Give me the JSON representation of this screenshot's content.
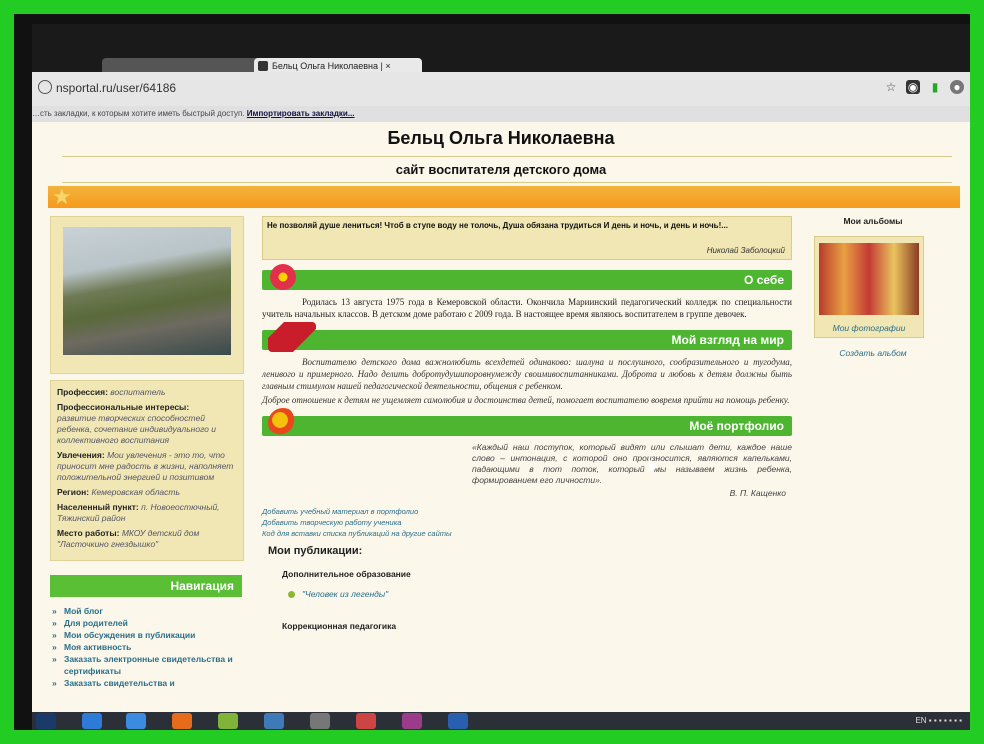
{
  "browser": {
    "tab_active_title": "Бельц Ольга Николаевна | ×",
    "address": "nsportal.ru/user/64186",
    "bookmarks_text": "…сть закладки, к которым хотите иметь быстрый доступ. ",
    "bookmarks_link": "Импортировать закладки..."
  },
  "site": {
    "title": "Бельц Ольга Николаевна",
    "subtitle": "сайт воспитателя детского дома"
  },
  "profile": {
    "profession_label": "Профессия:",
    "profession_value": "воспитатель",
    "interests_label": "Профессиональные интересы:",
    "interests_value": "развитие творческих способностей ребенка, сочетание индивидуального и коллективного воспитания",
    "hobbies_label": "Увлечения:",
    "hobbies_value": "Мои увлечения - это то, что приносит мне радость в жизни, наполняет положительной энергией и позитивом",
    "region_label": "Регион:",
    "region_value": "Кемеровская область",
    "locality_label": "Населенный пункт:",
    "locality_value": "п. Новоеостючный, Тяжинский район",
    "work_label": "Место работы:",
    "work_value": "МКОУ детский дом \"Ласточкино гнездышко\""
  },
  "nav": {
    "heading": "Навигация",
    "items": [
      "Мой блог",
      "Для родителей",
      "Мои обсуждения в публикации",
      "Моя активность",
      "Заказать электронные свидетельства и сертификаты",
      "Заказать свидетельства и"
    ]
  },
  "quote": {
    "text": "Не позволяй душе лениться! Чтоб в ступе воду не толочь, Душа обязана трудиться И день и ночь, и день и ночь!...",
    "author": "Николай Заболоцкий"
  },
  "sections": {
    "about_title": "О себе",
    "about_text": "Родилась 13 августа 1975 года в Кемеровской области. Окончила Мариинский педагогический колледж по специальности учитель начальных классов.    В детском доме работаю с 2009 года.  В настоящее время являюсь воспитателем в группе девочек.",
    "view_title": "Мой взгляд на мир",
    "view_text1": "Воспитателю детского дома важнолюбить всехдетей одинаково: шалуна и послушного, сообразительного и тугодума, ленивого и примерного. Надо делить добротудушипоровнумежду своимивоспитанниками. Доброта и любовь к детям должны быть главным стимулом нашей педагогической деятельности, общения с ребенком.",
    "view_text2": "Доброе отношение к детям не ущемляет самолюбия и достоинства детей, помогает воспитателю вовремя прийти на помощь ребенку.",
    "portfolio_title": "Моё портфолио",
    "portfolio_quote": "«Каждый наш поступок, который видят или слышат дети, каждое наше слово – интонация, с которой оно произносится, являются капельками, падающими в тот поток, который мы называем жизнь ребенка, формированием его личности».",
    "portfolio_author": "В. П. Кащенко"
  },
  "links": {
    "add_material": "Добавить учебный материал в портфолио",
    "add_student_work": "Добавить творческую работу ученика",
    "embed_code": "Код для вставки списка публикаций на другие сайты"
  },
  "publications": {
    "title": "Мои публикации:",
    "cat1": "Дополнительное образование",
    "item1": "\"Человек из легенды\"",
    "cat2": "Коррекционная педагогика"
  },
  "albums": {
    "title": "Мои альбомы",
    "caption": "Мои фотографии",
    "create": "Создать альбом"
  },
  "taskbar": {
    "lang": "EN"
  },
  "colors": {
    "frame": "#22cc22",
    "section_green": "#4eb530",
    "banner_orange": "#f59a1c",
    "page_bg": "#fbf7ea",
    "link": "#2a6f8a"
  }
}
